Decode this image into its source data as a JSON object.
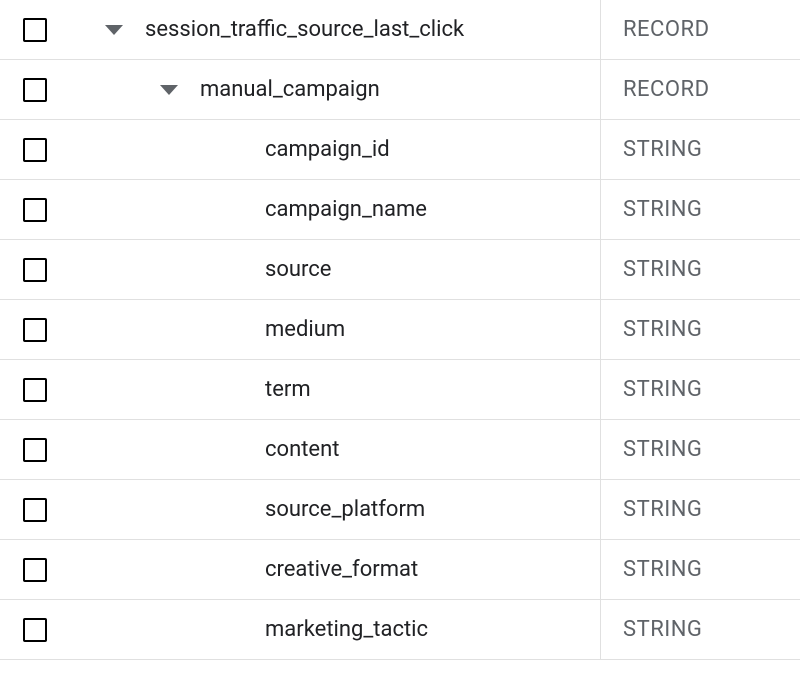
{
  "schema": {
    "rows": [
      {
        "name": "session_traffic_source_last_click",
        "type": "RECORD",
        "indent": 0,
        "expandable": true
      },
      {
        "name": "manual_campaign",
        "type": "RECORD",
        "indent": 1,
        "expandable": true
      },
      {
        "name": "campaign_id",
        "type": "STRING",
        "indent": 2,
        "expandable": false
      },
      {
        "name": "campaign_name",
        "type": "STRING",
        "indent": 2,
        "expandable": false
      },
      {
        "name": "source",
        "type": "STRING",
        "indent": 2,
        "expandable": false
      },
      {
        "name": "medium",
        "type": "STRING",
        "indent": 2,
        "expandable": false
      },
      {
        "name": "term",
        "type": "STRING",
        "indent": 2,
        "expandable": false
      },
      {
        "name": "content",
        "type": "STRING",
        "indent": 2,
        "expandable": false
      },
      {
        "name": "source_platform",
        "type": "STRING",
        "indent": 2,
        "expandable": false
      },
      {
        "name": "creative_format",
        "type": "STRING",
        "indent": 2,
        "expandable": false
      },
      {
        "name": "marketing_tactic",
        "type": "STRING",
        "indent": 2,
        "expandable": false
      }
    ]
  }
}
